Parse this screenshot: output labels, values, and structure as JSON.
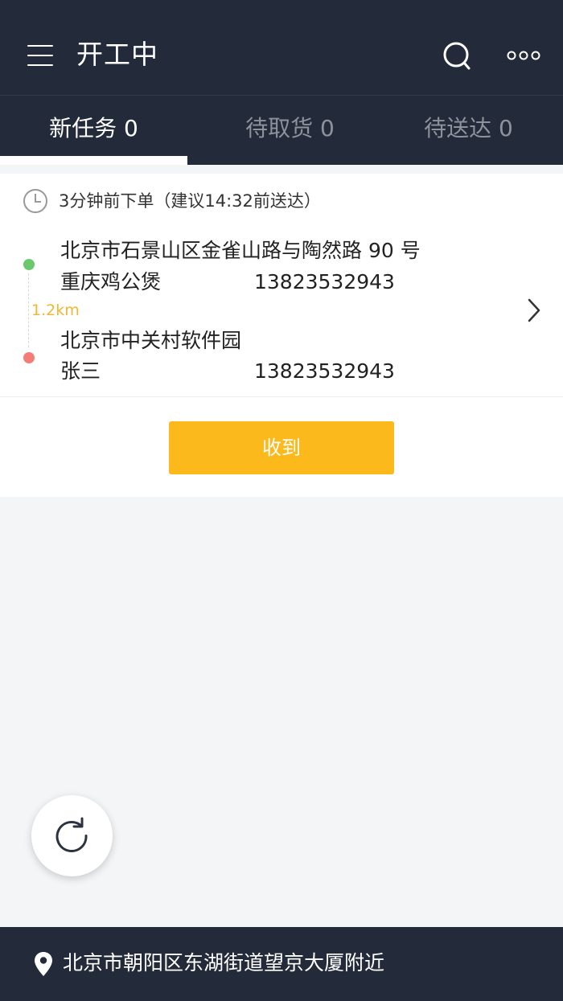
{
  "header": {
    "title": "开工中",
    "icons": [
      "menu-icon",
      "search-icon",
      "more-icon"
    ]
  },
  "tabs": [
    {
      "label": "新任务",
      "count": "0",
      "text": "新任务 0",
      "active": true
    },
    {
      "label": "待取货",
      "count": "0",
      "text": "待取货 0",
      "active": false
    },
    {
      "label": "待送达",
      "count": "0",
      "text": "待送达 0",
      "active": false
    }
  ],
  "order": {
    "time_text": "3分钟前下单（建议14:32前送达）",
    "pickup": {
      "address": "北京市石景山区金雀山路与陶然路 90 号",
      "name": "重庆鸡公煲",
      "phone": "13823532943"
    },
    "distance": "1.2km",
    "dropoff": {
      "address": "北京市中关村软件园",
      "name": "张三",
      "phone": "13823532943"
    },
    "action_label": "收到"
  },
  "footer": {
    "location": "北京市朝阳区东湖街道望京大厦附近"
  },
  "colors": {
    "header_bg": "#232a39",
    "accent": "#fbb91c",
    "pickup_dot": "#6cc86c",
    "dropoff_dot": "#f47d78",
    "distance_text": "#f3b632",
    "page_bg": "#f4f5f7"
  }
}
